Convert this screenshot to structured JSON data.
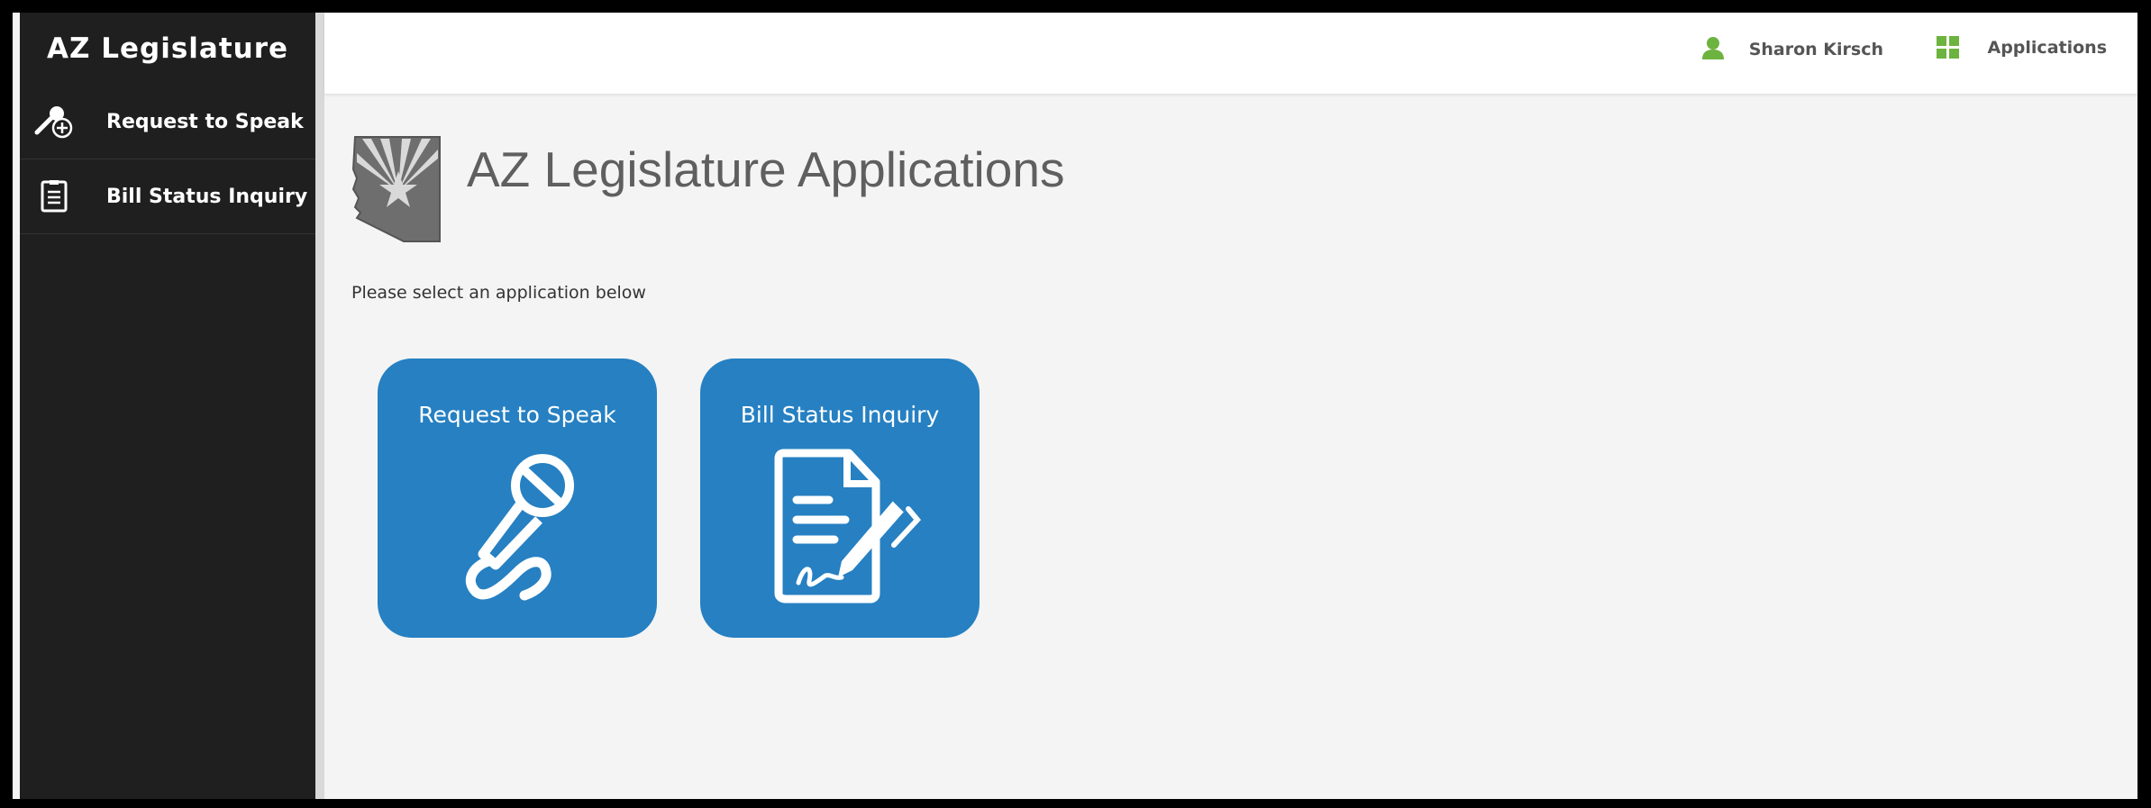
{
  "sidebar": {
    "brand": "AZ Legislature",
    "items": [
      {
        "label": "Request to Speak",
        "icon": "microphone-add-icon"
      },
      {
        "label": "Bill Status Inquiry",
        "icon": "document-icon"
      }
    ]
  },
  "header": {
    "user_name": "Sharon Kirsch",
    "user_icon": "user-icon",
    "apps_label": "Applications",
    "apps_icon": "grid-icon"
  },
  "main": {
    "title": "AZ Legislature Applications",
    "logo": "arizona-state-logo",
    "subtitle": "Please select an application below",
    "tiles": [
      {
        "label": "Request to Speak",
        "icon": "microphone-icon"
      },
      {
        "label": "Bill Status Inquiry",
        "icon": "document-pen-icon"
      }
    ]
  },
  "colors": {
    "sidebar_bg": "#1f1f1f",
    "tile_bg": "#2680c2",
    "accent_green": "#6db33f",
    "page_bg": "#f4f4f4"
  }
}
